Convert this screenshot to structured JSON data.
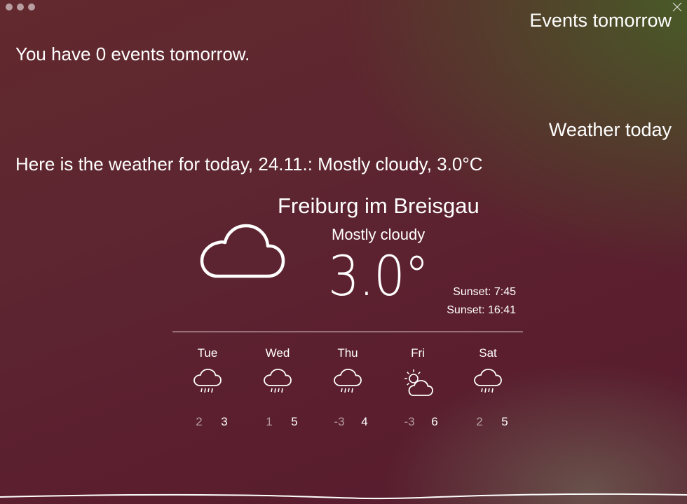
{
  "window": {
    "controls": [
      "close",
      "minimize",
      "zoom"
    ]
  },
  "events": {
    "title": "Events tomorrow",
    "text": "You have 0 events tomorrow."
  },
  "weather": {
    "title": "Weather today",
    "text": "Here is the weather for today, 24.11.: Mostly cloudy, 3.0°C",
    "city": "Freiburg im Breisgau",
    "condition": "Mostly cloudy",
    "temperature": "3.0°",
    "main_icon": "cloud-icon",
    "sunrise": "Sunset: 7:45",
    "sunset": "Sunset: 16:41"
  },
  "forecast": [
    {
      "day": "Tue",
      "icon": "rain-icon",
      "min": "2",
      "max": "3"
    },
    {
      "day": "Wed",
      "icon": "rain-icon",
      "min": "1",
      "max": "5"
    },
    {
      "day": "Thu",
      "icon": "rain-icon",
      "min": "-3",
      "max": "4"
    },
    {
      "day": "Fri",
      "icon": "partly-sunny-icon",
      "min": "-3",
      "max": "6"
    },
    {
      "day": "Sat",
      "icon": "rain-icon",
      "min": "2",
      "max": "5"
    }
  ],
  "colors": {
    "background_top": "#62292e",
    "background_bottom": "#561b2d",
    "accent_green": "#465f26",
    "text": "#ffffff"
  }
}
